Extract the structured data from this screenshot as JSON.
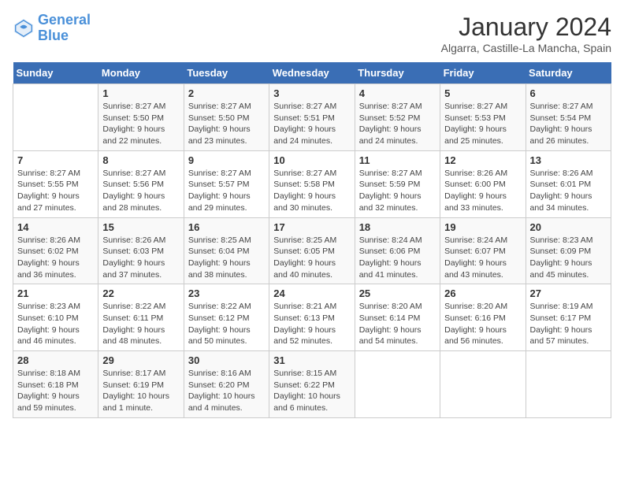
{
  "logo": {
    "line1": "General",
    "line2": "Blue"
  },
  "title": "January 2024",
  "location": "Algarra, Castille-La Mancha, Spain",
  "weekdays": [
    "Sunday",
    "Monday",
    "Tuesday",
    "Wednesday",
    "Thursday",
    "Friday",
    "Saturday"
  ],
  "weeks": [
    [
      {
        "day": "",
        "sunrise": "",
        "sunset": "",
        "daylight": ""
      },
      {
        "day": "1",
        "sunrise": "Sunrise: 8:27 AM",
        "sunset": "Sunset: 5:50 PM",
        "daylight": "Daylight: 9 hours and 22 minutes."
      },
      {
        "day": "2",
        "sunrise": "Sunrise: 8:27 AM",
        "sunset": "Sunset: 5:50 PM",
        "daylight": "Daylight: 9 hours and 23 minutes."
      },
      {
        "day": "3",
        "sunrise": "Sunrise: 8:27 AM",
        "sunset": "Sunset: 5:51 PM",
        "daylight": "Daylight: 9 hours and 24 minutes."
      },
      {
        "day": "4",
        "sunrise": "Sunrise: 8:27 AM",
        "sunset": "Sunset: 5:52 PM",
        "daylight": "Daylight: 9 hours and 24 minutes."
      },
      {
        "day": "5",
        "sunrise": "Sunrise: 8:27 AM",
        "sunset": "Sunset: 5:53 PM",
        "daylight": "Daylight: 9 hours and 25 minutes."
      },
      {
        "day": "6",
        "sunrise": "Sunrise: 8:27 AM",
        "sunset": "Sunset: 5:54 PM",
        "daylight": "Daylight: 9 hours and 26 minutes."
      }
    ],
    [
      {
        "day": "7",
        "sunrise": "Sunrise: 8:27 AM",
        "sunset": "Sunset: 5:55 PM",
        "daylight": "Daylight: 9 hours and 27 minutes."
      },
      {
        "day": "8",
        "sunrise": "Sunrise: 8:27 AM",
        "sunset": "Sunset: 5:56 PM",
        "daylight": "Daylight: 9 hours and 28 minutes."
      },
      {
        "day": "9",
        "sunrise": "Sunrise: 8:27 AM",
        "sunset": "Sunset: 5:57 PM",
        "daylight": "Daylight: 9 hours and 29 minutes."
      },
      {
        "day": "10",
        "sunrise": "Sunrise: 8:27 AM",
        "sunset": "Sunset: 5:58 PM",
        "daylight": "Daylight: 9 hours and 30 minutes."
      },
      {
        "day": "11",
        "sunrise": "Sunrise: 8:27 AM",
        "sunset": "Sunset: 5:59 PM",
        "daylight": "Daylight: 9 hours and 32 minutes."
      },
      {
        "day": "12",
        "sunrise": "Sunrise: 8:26 AM",
        "sunset": "Sunset: 6:00 PM",
        "daylight": "Daylight: 9 hours and 33 minutes."
      },
      {
        "day": "13",
        "sunrise": "Sunrise: 8:26 AM",
        "sunset": "Sunset: 6:01 PM",
        "daylight": "Daylight: 9 hours and 34 minutes."
      }
    ],
    [
      {
        "day": "14",
        "sunrise": "Sunrise: 8:26 AM",
        "sunset": "Sunset: 6:02 PM",
        "daylight": "Daylight: 9 hours and 36 minutes."
      },
      {
        "day": "15",
        "sunrise": "Sunrise: 8:26 AM",
        "sunset": "Sunset: 6:03 PM",
        "daylight": "Daylight: 9 hours and 37 minutes."
      },
      {
        "day": "16",
        "sunrise": "Sunrise: 8:25 AM",
        "sunset": "Sunset: 6:04 PM",
        "daylight": "Daylight: 9 hours and 38 minutes."
      },
      {
        "day": "17",
        "sunrise": "Sunrise: 8:25 AM",
        "sunset": "Sunset: 6:05 PM",
        "daylight": "Daylight: 9 hours and 40 minutes."
      },
      {
        "day": "18",
        "sunrise": "Sunrise: 8:24 AM",
        "sunset": "Sunset: 6:06 PM",
        "daylight": "Daylight: 9 hours and 41 minutes."
      },
      {
        "day": "19",
        "sunrise": "Sunrise: 8:24 AM",
        "sunset": "Sunset: 6:07 PM",
        "daylight": "Daylight: 9 hours and 43 minutes."
      },
      {
        "day": "20",
        "sunrise": "Sunrise: 8:23 AM",
        "sunset": "Sunset: 6:09 PM",
        "daylight": "Daylight: 9 hours and 45 minutes."
      }
    ],
    [
      {
        "day": "21",
        "sunrise": "Sunrise: 8:23 AM",
        "sunset": "Sunset: 6:10 PM",
        "daylight": "Daylight: 9 hours and 46 minutes."
      },
      {
        "day": "22",
        "sunrise": "Sunrise: 8:22 AM",
        "sunset": "Sunset: 6:11 PM",
        "daylight": "Daylight: 9 hours and 48 minutes."
      },
      {
        "day": "23",
        "sunrise": "Sunrise: 8:22 AM",
        "sunset": "Sunset: 6:12 PM",
        "daylight": "Daylight: 9 hours and 50 minutes."
      },
      {
        "day": "24",
        "sunrise": "Sunrise: 8:21 AM",
        "sunset": "Sunset: 6:13 PM",
        "daylight": "Daylight: 9 hours and 52 minutes."
      },
      {
        "day": "25",
        "sunrise": "Sunrise: 8:20 AM",
        "sunset": "Sunset: 6:14 PM",
        "daylight": "Daylight: 9 hours and 54 minutes."
      },
      {
        "day": "26",
        "sunrise": "Sunrise: 8:20 AM",
        "sunset": "Sunset: 6:16 PM",
        "daylight": "Daylight: 9 hours and 56 minutes."
      },
      {
        "day": "27",
        "sunrise": "Sunrise: 8:19 AM",
        "sunset": "Sunset: 6:17 PM",
        "daylight": "Daylight: 9 hours and 57 minutes."
      }
    ],
    [
      {
        "day": "28",
        "sunrise": "Sunrise: 8:18 AM",
        "sunset": "Sunset: 6:18 PM",
        "daylight": "Daylight: 9 hours and 59 minutes."
      },
      {
        "day": "29",
        "sunrise": "Sunrise: 8:17 AM",
        "sunset": "Sunset: 6:19 PM",
        "daylight": "Daylight: 10 hours and 1 minute."
      },
      {
        "day": "30",
        "sunrise": "Sunrise: 8:16 AM",
        "sunset": "Sunset: 6:20 PM",
        "daylight": "Daylight: 10 hours and 4 minutes."
      },
      {
        "day": "31",
        "sunrise": "Sunrise: 8:15 AM",
        "sunset": "Sunset: 6:22 PM",
        "daylight": "Daylight: 10 hours and 6 minutes."
      },
      {
        "day": "",
        "sunrise": "",
        "sunset": "",
        "daylight": ""
      },
      {
        "day": "",
        "sunrise": "",
        "sunset": "",
        "daylight": ""
      },
      {
        "day": "",
        "sunrise": "",
        "sunset": "",
        "daylight": ""
      }
    ]
  ]
}
